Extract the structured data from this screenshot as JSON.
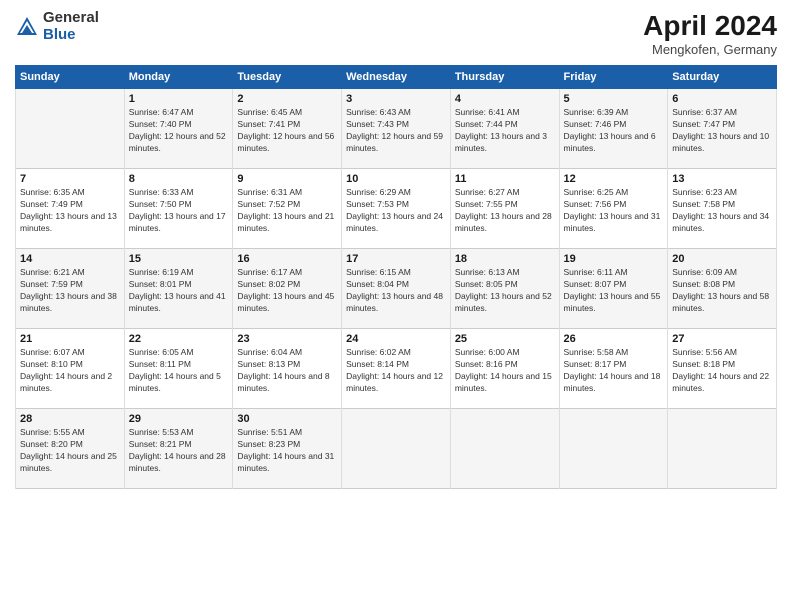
{
  "header": {
    "logo_general": "General",
    "logo_blue": "Blue",
    "month_title": "April 2024",
    "subtitle": "Mengkofen, Germany"
  },
  "columns": [
    "Sunday",
    "Monday",
    "Tuesday",
    "Wednesday",
    "Thursday",
    "Friday",
    "Saturday"
  ],
  "weeks": [
    [
      {
        "day": "",
        "sunrise": "",
        "sunset": "",
        "daylight": ""
      },
      {
        "day": "1",
        "sunrise": "Sunrise: 6:47 AM",
        "sunset": "Sunset: 7:40 PM",
        "daylight": "Daylight: 12 hours and 52 minutes."
      },
      {
        "day": "2",
        "sunrise": "Sunrise: 6:45 AM",
        "sunset": "Sunset: 7:41 PM",
        "daylight": "Daylight: 12 hours and 56 minutes."
      },
      {
        "day": "3",
        "sunrise": "Sunrise: 6:43 AM",
        "sunset": "Sunset: 7:43 PM",
        "daylight": "Daylight: 12 hours and 59 minutes."
      },
      {
        "day": "4",
        "sunrise": "Sunrise: 6:41 AM",
        "sunset": "Sunset: 7:44 PM",
        "daylight": "Daylight: 13 hours and 3 minutes."
      },
      {
        "day": "5",
        "sunrise": "Sunrise: 6:39 AM",
        "sunset": "Sunset: 7:46 PM",
        "daylight": "Daylight: 13 hours and 6 minutes."
      },
      {
        "day": "6",
        "sunrise": "Sunrise: 6:37 AM",
        "sunset": "Sunset: 7:47 PM",
        "daylight": "Daylight: 13 hours and 10 minutes."
      }
    ],
    [
      {
        "day": "7",
        "sunrise": "Sunrise: 6:35 AM",
        "sunset": "Sunset: 7:49 PM",
        "daylight": "Daylight: 13 hours and 13 minutes."
      },
      {
        "day": "8",
        "sunrise": "Sunrise: 6:33 AM",
        "sunset": "Sunset: 7:50 PM",
        "daylight": "Daylight: 13 hours and 17 minutes."
      },
      {
        "day": "9",
        "sunrise": "Sunrise: 6:31 AM",
        "sunset": "Sunset: 7:52 PM",
        "daylight": "Daylight: 13 hours and 21 minutes."
      },
      {
        "day": "10",
        "sunrise": "Sunrise: 6:29 AM",
        "sunset": "Sunset: 7:53 PM",
        "daylight": "Daylight: 13 hours and 24 minutes."
      },
      {
        "day": "11",
        "sunrise": "Sunrise: 6:27 AM",
        "sunset": "Sunset: 7:55 PM",
        "daylight": "Daylight: 13 hours and 28 minutes."
      },
      {
        "day": "12",
        "sunrise": "Sunrise: 6:25 AM",
        "sunset": "Sunset: 7:56 PM",
        "daylight": "Daylight: 13 hours and 31 minutes."
      },
      {
        "day": "13",
        "sunrise": "Sunrise: 6:23 AM",
        "sunset": "Sunset: 7:58 PM",
        "daylight": "Daylight: 13 hours and 34 minutes."
      }
    ],
    [
      {
        "day": "14",
        "sunrise": "Sunrise: 6:21 AM",
        "sunset": "Sunset: 7:59 PM",
        "daylight": "Daylight: 13 hours and 38 minutes."
      },
      {
        "day": "15",
        "sunrise": "Sunrise: 6:19 AM",
        "sunset": "Sunset: 8:01 PM",
        "daylight": "Daylight: 13 hours and 41 minutes."
      },
      {
        "day": "16",
        "sunrise": "Sunrise: 6:17 AM",
        "sunset": "Sunset: 8:02 PM",
        "daylight": "Daylight: 13 hours and 45 minutes."
      },
      {
        "day": "17",
        "sunrise": "Sunrise: 6:15 AM",
        "sunset": "Sunset: 8:04 PM",
        "daylight": "Daylight: 13 hours and 48 minutes."
      },
      {
        "day": "18",
        "sunrise": "Sunrise: 6:13 AM",
        "sunset": "Sunset: 8:05 PM",
        "daylight": "Daylight: 13 hours and 52 minutes."
      },
      {
        "day": "19",
        "sunrise": "Sunrise: 6:11 AM",
        "sunset": "Sunset: 8:07 PM",
        "daylight": "Daylight: 13 hours and 55 minutes."
      },
      {
        "day": "20",
        "sunrise": "Sunrise: 6:09 AM",
        "sunset": "Sunset: 8:08 PM",
        "daylight": "Daylight: 13 hours and 58 minutes."
      }
    ],
    [
      {
        "day": "21",
        "sunrise": "Sunrise: 6:07 AM",
        "sunset": "Sunset: 8:10 PM",
        "daylight": "Daylight: 14 hours and 2 minutes."
      },
      {
        "day": "22",
        "sunrise": "Sunrise: 6:05 AM",
        "sunset": "Sunset: 8:11 PM",
        "daylight": "Daylight: 14 hours and 5 minutes."
      },
      {
        "day": "23",
        "sunrise": "Sunrise: 6:04 AM",
        "sunset": "Sunset: 8:13 PM",
        "daylight": "Daylight: 14 hours and 8 minutes."
      },
      {
        "day": "24",
        "sunrise": "Sunrise: 6:02 AM",
        "sunset": "Sunset: 8:14 PM",
        "daylight": "Daylight: 14 hours and 12 minutes."
      },
      {
        "day": "25",
        "sunrise": "Sunrise: 6:00 AM",
        "sunset": "Sunset: 8:16 PM",
        "daylight": "Daylight: 14 hours and 15 minutes."
      },
      {
        "day": "26",
        "sunrise": "Sunrise: 5:58 AM",
        "sunset": "Sunset: 8:17 PM",
        "daylight": "Daylight: 14 hours and 18 minutes."
      },
      {
        "day": "27",
        "sunrise": "Sunrise: 5:56 AM",
        "sunset": "Sunset: 8:18 PM",
        "daylight": "Daylight: 14 hours and 22 minutes."
      }
    ],
    [
      {
        "day": "28",
        "sunrise": "Sunrise: 5:55 AM",
        "sunset": "Sunset: 8:20 PM",
        "daylight": "Daylight: 14 hours and 25 minutes."
      },
      {
        "day": "29",
        "sunrise": "Sunrise: 5:53 AM",
        "sunset": "Sunset: 8:21 PM",
        "daylight": "Daylight: 14 hours and 28 minutes."
      },
      {
        "day": "30",
        "sunrise": "Sunrise: 5:51 AM",
        "sunset": "Sunset: 8:23 PM",
        "daylight": "Daylight: 14 hours and 31 minutes."
      },
      {
        "day": "",
        "sunrise": "",
        "sunset": "",
        "daylight": ""
      },
      {
        "day": "",
        "sunrise": "",
        "sunset": "",
        "daylight": ""
      },
      {
        "day": "",
        "sunrise": "",
        "sunset": "",
        "daylight": ""
      },
      {
        "day": "",
        "sunrise": "",
        "sunset": "",
        "daylight": ""
      }
    ]
  ]
}
